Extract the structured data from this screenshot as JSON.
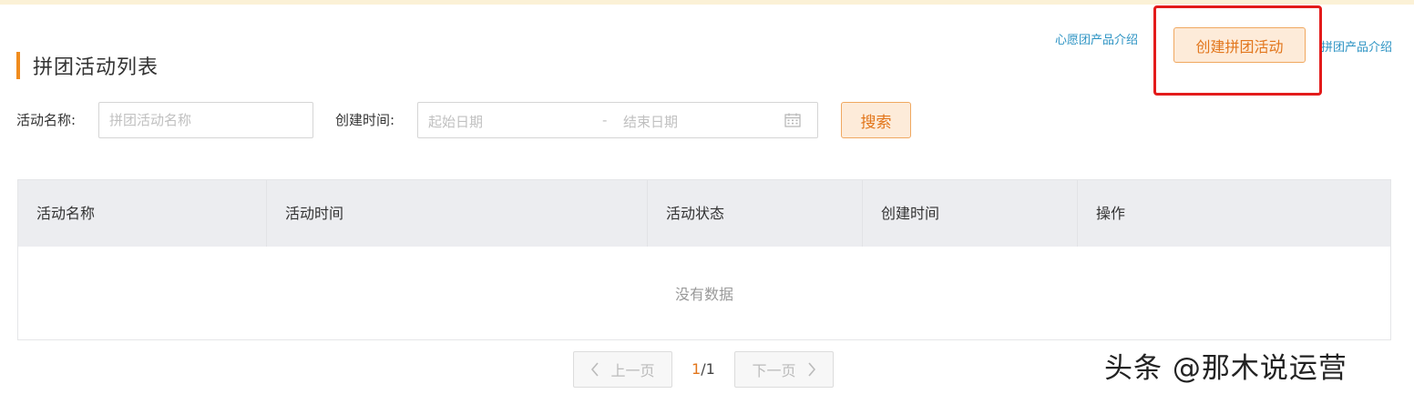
{
  "header": {
    "title": "拼团活动列表",
    "accent_color": "#f08c1e"
  },
  "links": {
    "wish_group_intro": "心愿团产品介绍",
    "group_intro": "拼团产品介绍"
  },
  "create_button": {
    "label": "创建拼团活动"
  },
  "filters": {
    "name_label": "活动名称:",
    "name_placeholder": "拼团活动名称",
    "time_label": "创建时间:",
    "start_placeholder": "起始日期",
    "separator": "-",
    "end_placeholder": "结束日期",
    "calendar_icon": "calendar-icon",
    "search_label": "搜索"
  },
  "table": {
    "columns": [
      "活动名称",
      "活动时间",
      "活动状态",
      "创建时间",
      "操作"
    ],
    "rows": [],
    "empty_text": "没有数据"
  },
  "pagination": {
    "prev_label": "上一页",
    "next_label": "下一页",
    "current": "1",
    "total": "1"
  },
  "watermark": "头条 @那木说运营",
  "colors": {
    "brand_orange": "#e2761c",
    "button_bg": "#fdebd9",
    "link_blue": "#2c93c3",
    "highlight_red": "#e31b1b"
  }
}
